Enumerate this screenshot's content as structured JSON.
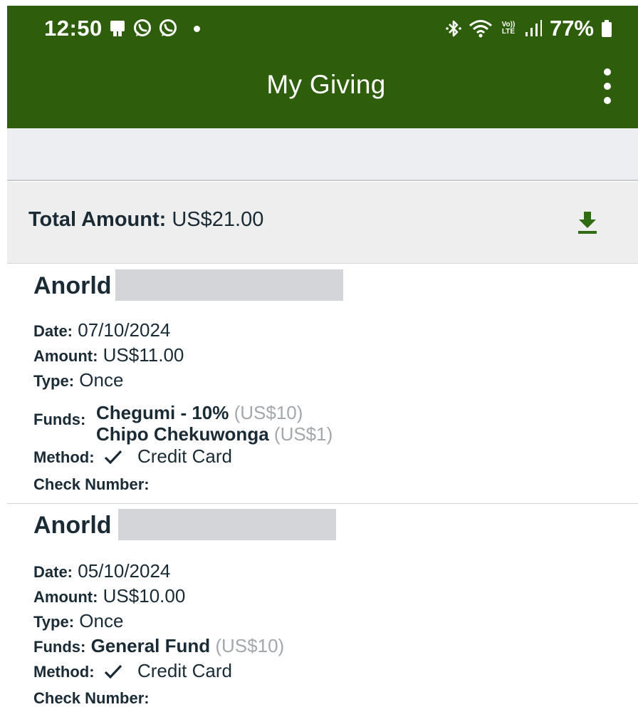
{
  "status_bar": {
    "time": "12:50",
    "volte_top": "Vo))",
    "volte_bottom": "LTE",
    "battery": "77%",
    "colors": {
      "accent": "#2e5e0c"
    },
    "icons": [
      "notification-icon",
      "whatsapp-icon",
      "whatsapp-icon",
      "bluetooth-icon",
      "wifi-icon",
      "signal-icon",
      "battery-icon"
    ]
  },
  "app_bar": {
    "title": "My Giving",
    "menu_icon": "overflow-menu-icon"
  },
  "summary": {
    "total_label": "Total Amount:",
    "total_value": "US$21.00",
    "download_icon": "download-icon"
  },
  "labels": {
    "date": "Date:",
    "amount": "Amount:",
    "type": "Type:",
    "funds": "Funds:",
    "method": "Method:",
    "check_number": "Check Number:"
  },
  "transactions": [
    {
      "donor_first_name": "Anorld",
      "date": "07/10/2024",
      "amount": "US$11.00",
      "type": "Once",
      "funds": [
        {
          "name": "Chegumi - 10%",
          "amount": "(US$10)"
        },
        {
          "name": "Chipo Chekuwonga",
          "amount": "(US$1)"
        }
      ],
      "method": "Credit Card",
      "check_number": ""
    },
    {
      "donor_first_name": "Anorld",
      "date": "05/10/2024",
      "amount": "US$10.00",
      "type": "Once",
      "funds": [
        {
          "name": "General Fund",
          "amount": "(US$10)"
        }
      ],
      "method": "Credit Card",
      "check_number": ""
    }
  ]
}
